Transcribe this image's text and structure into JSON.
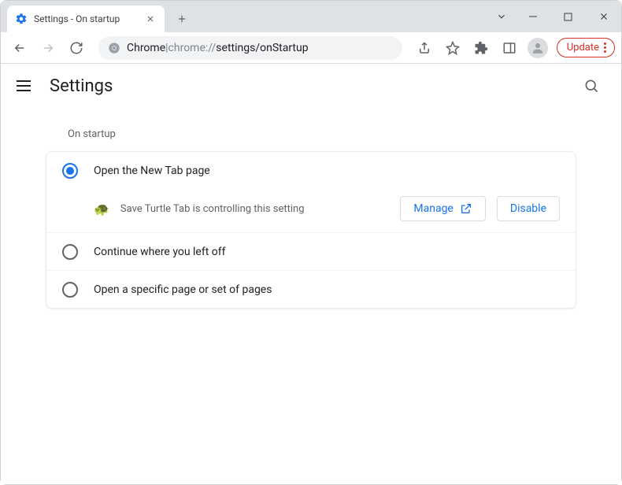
{
  "window": {
    "tab_title": "Settings - On startup"
  },
  "omnibox": {
    "prefix": "Chrome",
    "separator": " | ",
    "path_scheme": "chrome://",
    "path_rest": "settings/onStartup"
  },
  "toolbar": {
    "update_label": "Update"
  },
  "header": {
    "title": "Settings"
  },
  "section": {
    "label": "On startup"
  },
  "options": {
    "open_new_tab": "Open the New Tab page",
    "continue": "Continue where you left off",
    "specific": "Open a specific page or set of pages"
  },
  "extension_notice": {
    "icon": "🐢",
    "text": "Save Turtle Tab is controlling this setting",
    "manage": "Manage",
    "disable": "Disable"
  },
  "colors": {
    "primary": "#1a73e8",
    "danger": "#d93025"
  }
}
